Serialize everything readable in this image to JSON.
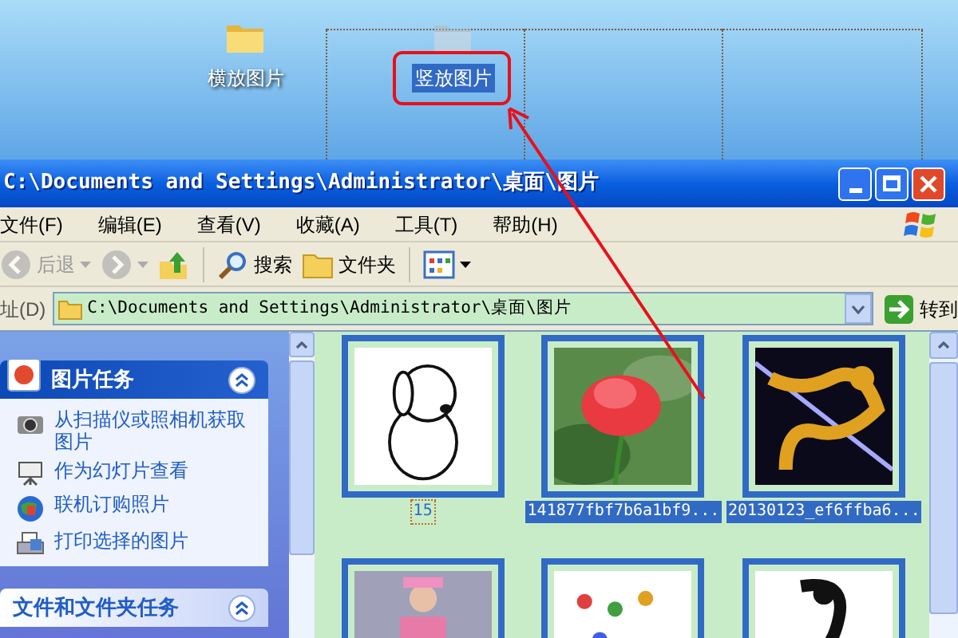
{
  "desktop": {
    "icons": [
      {
        "label": "横放图片",
        "selected": false
      },
      {
        "label": "竖放图片",
        "selected": true
      }
    ]
  },
  "window": {
    "title": "C:\\Documents and Settings\\Administrator\\桌面\\图片"
  },
  "menu": [
    "文件(F)",
    "编辑(E)",
    "查看(V)",
    "收藏(A)",
    "工具(T)",
    "帮助(H)"
  ],
  "toolbar": [
    {
      "kind": "back",
      "label": "后退",
      "disabled": true
    },
    {
      "kind": "forward",
      "disabled": true
    },
    {
      "kind": "up",
      "disabled": false
    },
    {
      "kind": "search",
      "label": "搜索",
      "disabled": false
    },
    {
      "kind": "folders",
      "label": "文件夹",
      "disabled": false
    },
    {
      "kind": "views",
      "disabled": false
    }
  ],
  "address": {
    "label": "址(D)",
    "value": "C:\\Documents and Settings\\Administrator\\桌面\\图片",
    "go": "转到"
  },
  "task_panels": [
    {
      "title": "图片任务",
      "expanded": true,
      "items": [
        {
          "kind": "camera",
          "label": "从扫描仪或照相机获取图片"
        },
        {
          "kind": "slideshow",
          "label": "作为幻灯片查看"
        },
        {
          "kind": "order",
          "label": "联机订购照片"
        },
        {
          "kind": "print",
          "label": "打印选择的图片"
        }
      ]
    },
    {
      "title": "文件和文件夹任务",
      "expanded": true
    }
  ],
  "thumbnails": [
    {
      "kind": "picture",
      "label": "15",
      "selected": false,
      "focused": true
    },
    {
      "kind": "picture",
      "label": "141877fbf7b6a1bf9...",
      "selected": true,
      "focused": false
    },
    {
      "kind": "picture",
      "label": "20130123_ef6ffba6...",
      "selected": true,
      "focused": false
    },
    {
      "kind": "picture"
    },
    {
      "kind": "picture"
    },
    {
      "kind": "picture"
    }
  ]
}
